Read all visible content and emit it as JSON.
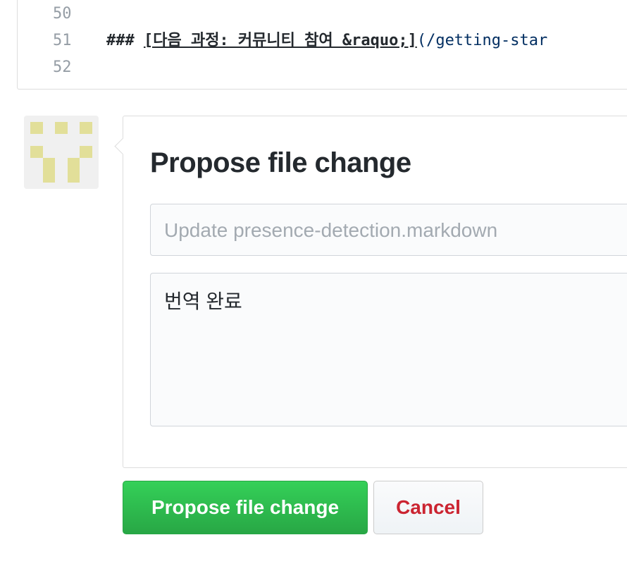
{
  "code": {
    "lines": [
      {
        "num": "50",
        "text": ""
      },
      {
        "num": "51",
        "prefix": "### ",
        "link": "[다음 과정: 커뮤니티 참여 &raquo;]",
        "url": "(/getting-star"
      },
      {
        "num": "52",
        "text": ""
      }
    ]
  },
  "form": {
    "heading": "Propose file change",
    "title_placeholder": "Update presence-detection.markdown",
    "title_value": "",
    "description": "번역 완료"
  },
  "buttons": {
    "propose": "Propose file change",
    "cancel": "Cancel"
  },
  "colors": {
    "accent": "#28a745",
    "cancel": "#cb2431",
    "identicon": "#e2df99"
  }
}
